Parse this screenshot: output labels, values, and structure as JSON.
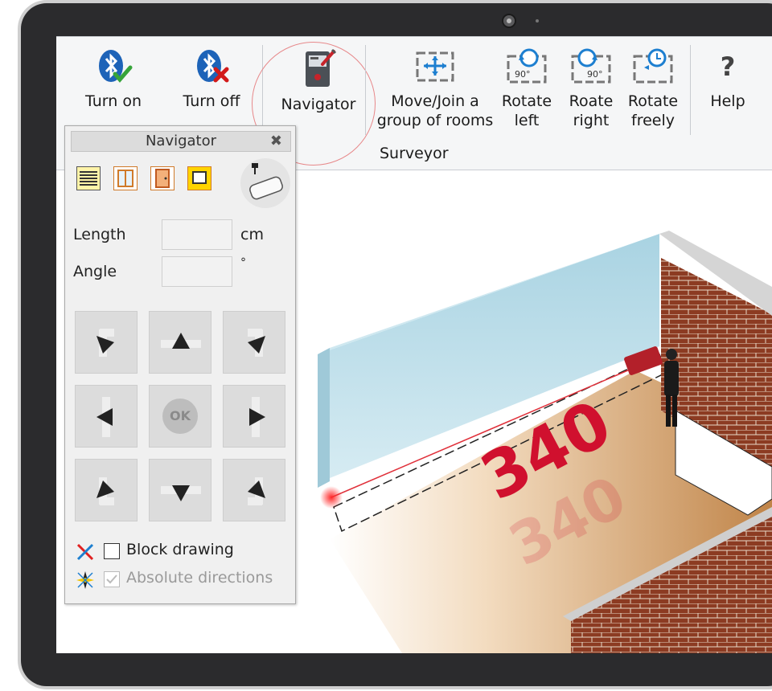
{
  "ribbon": {
    "buttons": [
      {
        "id": "turn-on",
        "label": "Turn on"
      },
      {
        "id": "turn-off",
        "label": "Turn off"
      },
      {
        "id": "navigator",
        "label": "Navigator"
      },
      {
        "id": "move-join",
        "label": "Move/Join a\ngroup of rooms"
      },
      {
        "id": "rotate-left",
        "label": "Rotate\nleft"
      },
      {
        "id": "rotate-right",
        "label": "Roate\nright"
      },
      {
        "id": "rotate-freely",
        "label": "Rotate\nfreely"
      },
      {
        "id": "help",
        "label": "Help"
      }
    ],
    "group_label": "Surveyor",
    "badge_90": "90°",
    "help_glyph": "?",
    "highlight_color": "#e7888a"
  },
  "navigator": {
    "title": "Navigator",
    "close_glyph": "✖",
    "length_label": "Length",
    "length_value": "",
    "length_unit": "cm",
    "angle_label": "Angle",
    "angle_value": "",
    "angle_unit": "°",
    "ok_label": "OK",
    "block_drawing_label": "Block drawing",
    "block_drawing_checked": false,
    "absolute_directions_label": "Absolute directions",
    "absolute_directions_checked": true,
    "absolute_directions_enabled": false
  },
  "scene": {
    "measurement": "340",
    "measurement_color": "#d0102e",
    "wall_color": "#b9dbe6",
    "brick_color": "#8c3b22",
    "floor_color": "#c9925a"
  }
}
